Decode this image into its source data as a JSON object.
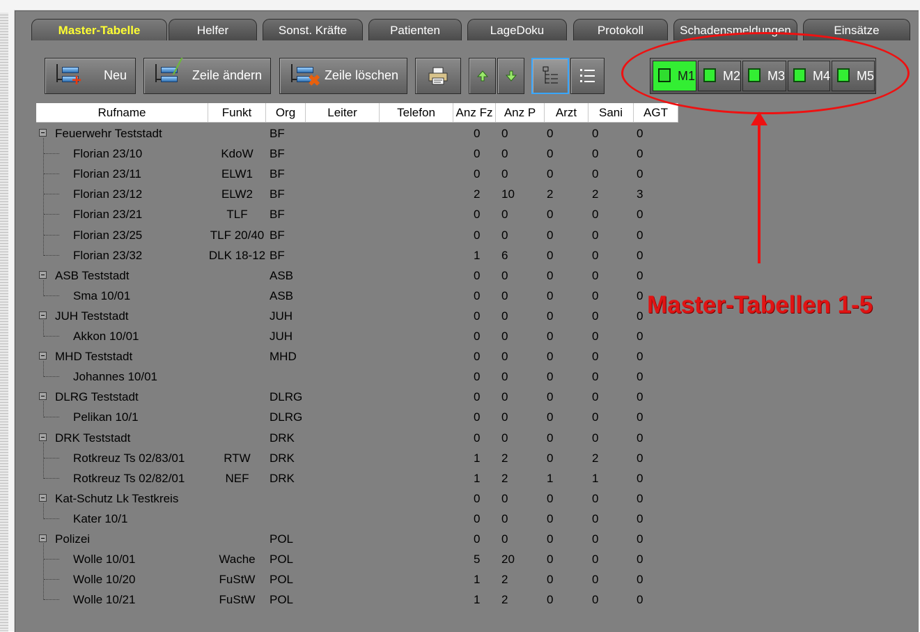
{
  "tabs": [
    {
      "label": "Master-Tabelle",
      "active": true
    },
    {
      "label": "Helfer"
    },
    {
      "label": "Sonst. Kräfte"
    },
    {
      "label": "Patienten"
    },
    {
      "label": "LageDoku"
    },
    {
      "label": "Protokoll"
    },
    {
      "label": "Schadensmeldungen"
    },
    {
      "label": "Einsätze"
    }
  ],
  "toolbar": {
    "new_label": "Neu",
    "edit_label": "Zeile ändern",
    "delete_label": "Zeile löschen",
    "print_icon": "printer-icon",
    "up_icon": "arrow-up-icon",
    "down_icon": "arrow-down-icon",
    "tree_view_icon": "tree-view-icon",
    "list_view_icon": "list-view-icon"
  },
  "master_tables": [
    {
      "label": "M1",
      "active": true
    },
    {
      "label": "M2"
    },
    {
      "label": "M3"
    },
    {
      "label": "M4"
    },
    {
      "label": "M5"
    }
  ],
  "columns": [
    "Rufname",
    "Funkt",
    "Org",
    "Leiter",
    "Telefon",
    "Anz Fz",
    "Anz P",
    "Arzt",
    "Sani",
    "AGT"
  ],
  "rows": [
    {
      "level": 0,
      "rufname": "Feuerwehr Teststadt",
      "funkt": "",
      "org": "BF",
      "anzfz": "0",
      "anzp": "0",
      "arzt": "0",
      "sani": "0",
      "agt": "0"
    },
    {
      "level": 1,
      "rufname": "Florian 23/10",
      "funkt": "KdoW",
      "org": "BF",
      "anzfz": "0",
      "anzp": "0",
      "arzt": "0",
      "sani": "0",
      "agt": "0"
    },
    {
      "level": 1,
      "rufname": "Florian 23/11",
      "funkt": "ELW1",
      "org": "BF",
      "anzfz": "0",
      "anzp": "0",
      "arzt": "0",
      "sani": "0",
      "agt": "0"
    },
    {
      "level": 1,
      "rufname": "Florian 23/12",
      "funkt": "ELW2",
      "org": "BF",
      "anzfz": "2",
      "anzp": "10",
      "arzt": "2",
      "sani": "2",
      "agt": "3"
    },
    {
      "level": 1,
      "rufname": "Florian 23/21",
      "funkt": "TLF",
      "org": "BF",
      "anzfz": "0",
      "anzp": "0",
      "arzt": "0",
      "sani": "0",
      "agt": "0"
    },
    {
      "level": 1,
      "rufname": "Florian 23/25",
      "funkt": "TLF 20/40",
      "org": "BF",
      "anzfz": "0",
      "anzp": "0",
      "arzt": "0",
      "sani": "0",
      "agt": "0"
    },
    {
      "level": 1,
      "rufname": "Florian 23/32",
      "funkt": "DLK 18-12",
      "org": "BF",
      "anzfz": "1",
      "anzp": "6",
      "arzt": "0",
      "sani": "0",
      "agt": "0"
    },
    {
      "level": 0,
      "rufname": "ASB Teststadt",
      "funkt": "",
      "org": "ASB",
      "anzfz": "0",
      "anzp": "0",
      "arzt": "0",
      "sani": "0",
      "agt": "0"
    },
    {
      "level": 1,
      "rufname": "Sma 10/01",
      "funkt": "",
      "org": "ASB",
      "anzfz": "0",
      "anzp": "0",
      "arzt": "0",
      "sani": "0",
      "agt": "0"
    },
    {
      "level": 0,
      "rufname": "JUH Teststadt",
      "funkt": "",
      "org": "JUH",
      "anzfz": "0",
      "anzp": "0",
      "arzt": "0",
      "sani": "0",
      "agt": "0"
    },
    {
      "level": 1,
      "rufname": "Akkon 10/01",
      "funkt": "",
      "org": "JUH",
      "anzfz": "0",
      "anzp": "0",
      "arzt": "0",
      "sani": "0",
      "agt": "0"
    },
    {
      "level": 0,
      "rufname": "MHD Teststadt",
      "funkt": "",
      "org": "MHD",
      "anzfz": "0",
      "anzp": "0",
      "arzt": "0",
      "sani": "0",
      "agt": "0"
    },
    {
      "level": 1,
      "rufname": "Johannes 10/01",
      "funkt": "",
      "org": "",
      "anzfz": "0",
      "anzp": "0",
      "arzt": "0",
      "sani": "0",
      "agt": "0"
    },
    {
      "level": 0,
      "rufname": "DLRG Teststadt",
      "funkt": "",
      "org": "DLRG",
      "anzfz": "0",
      "anzp": "0",
      "arzt": "0",
      "sani": "0",
      "agt": "0"
    },
    {
      "level": 1,
      "rufname": "Pelikan 10/1",
      "funkt": "",
      "org": "DLRG",
      "anzfz": "0",
      "anzp": "0",
      "arzt": "0",
      "sani": "0",
      "agt": "0"
    },
    {
      "level": 0,
      "rufname": "DRK Teststadt",
      "funkt": "",
      "org": "DRK",
      "anzfz": "0",
      "anzp": "0",
      "arzt": "0",
      "sani": "0",
      "agt": "0"
    },
    {
      "level": 1,
      "rufname": "Rotkreuz Ts 02/83/01",
      "funkt": "RTW",
      "org": "DRK",
      "anzfz": "1",
      "anzp": "2",
      "arzt": "0",
      "sani": "2",
      "agt": "0"
    },
    {
      "level": 1,
      "rufname": "Rotkreuz Ts 02/82/01",
      "funkt": "NEF",
      "org": "DRK",
      "anzfz": "1",
      "anzp": "2",
      "arzt": "1",
      "sani": "1",
      "agt": "0"
    },
    {
      "level": 0,
      "rufname": "Kat-Schutz Lk Testkreis",
      "funkt": "",
      "org": "",
      "anzfz": "0",
      "anzp": "0",
      "arzt": "0",
      "sani": "0",
      "agt": "0"
    },
    {
      "level": 1,
      "rufname": "Kater 10/1",
      "funkt": "",
      "org": "",
      "anzfz": "0",
      "anzp": "0",
      "arzt": "0",
      "sani": "0",
      "agt": "0"
    },
    {
      "level": 0,
      "rufname": "Polizei",
      "funkt": "",
      "org": "POL",
      "anzfz": "0",
      "anzp": "0",
      "arzt": "0",
      "sani": "0",
      "agt": "0"
    },
    {
      "level": 1,
      "rufname": "Wolle 10/01",
      "funkt": "Wache",
      "org": "POL",
      "anzfz": "5",
      "anzp": "20",
      "arzt": "0",
      "sani": "0",
      "agt": "0"
    },
    {
      "level": 1,
      "rufname": "Wolle 10/20",
      "funkt": "FuStW",
      "org": "POL",
      "anzfz": "1",
      "anzp": "2",
      "arzt": "0",
      "sani": "0",
      "agt": "0"
    },
    {
      "level": 1,
      "rufname": "Wolle 10/21",
      "funkt": "FuStW",
      "org": "POL",
      "anzfz": "1",
      "anzp": "2",
      "arzt": "0",
      "sani": "0",
      "agt": "0"
    }
  ],
  "annotation": {
    "text": "Master-Tabellen 1-5",
    "color": "#e01414"
  },
  "colors": {
    "panel": "#808080",
    "active_tab_text": "#ffff33",
    "master_active": "#33ee33",
    "selected_border": "#39a7ff"
  }
}
